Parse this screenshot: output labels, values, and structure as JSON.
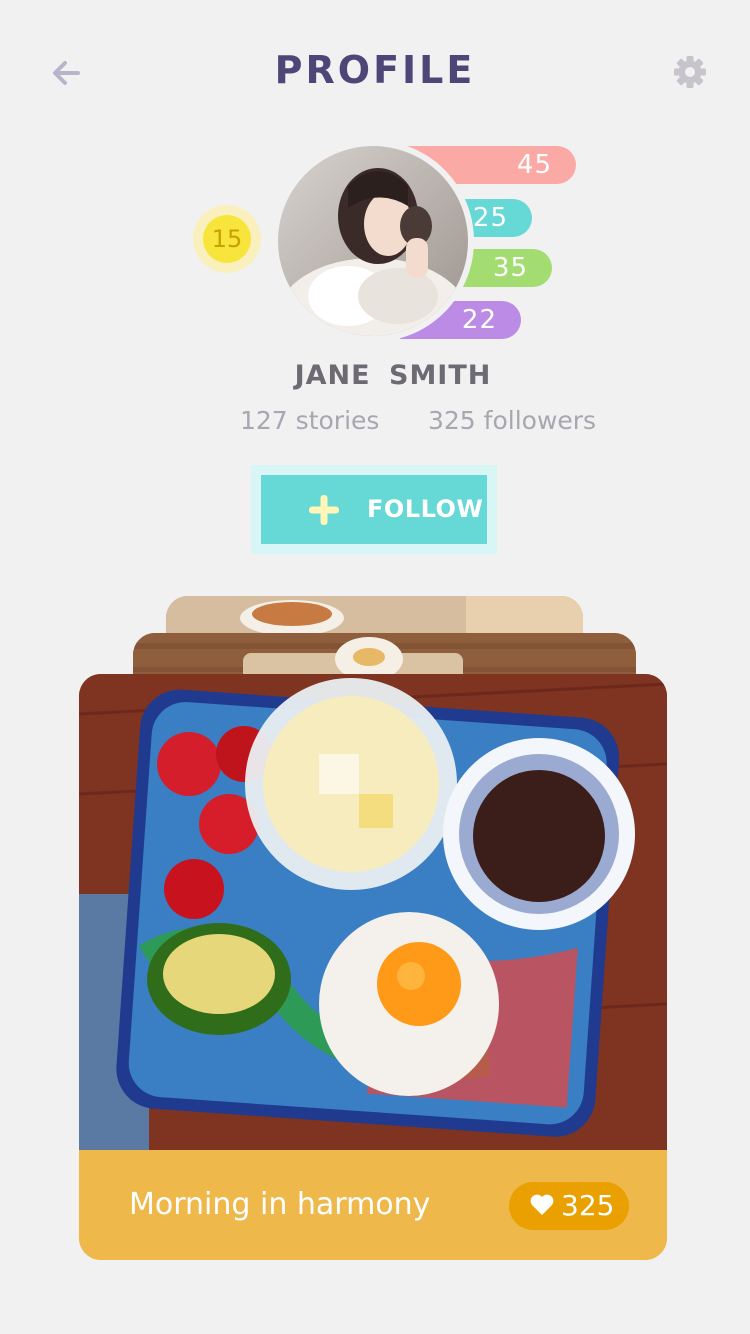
{
  "header": {
    "title": "PROFILE",
    "back_icon": "back-arrow-icon",
    "settings_icon": "gear-icon"
  },
  "profile": {
    "name": "JANE  SMITH",
    "stories": "127 stories",
    "followers": "325 followers",
    "level": "15",
    "stats": [
      "45",
      "25",
      "35",
      "22"
    ]
  },
  "follow_button": {
    "label": "FOLLOW",
    "icon": "plus-icon"
  },
  "card": {
    "title": "Morning in harmony",
    "likes": "325",
    "like_icon": "heart-icon"
  },
  "colors": {
    "title": "#4f4678",
    "accent_teal": "#66d8d6",
    "stat_pink": "#fba9a5",
    "stat_teal": "#66d8d6",
    "stat_green": "#a3dd71",
    "stat_purple": "#bb8be6",
    "level_yellow": "#f7e53c",
    "card_footer": "#efb84b",
    "like_pill": "#eaa000"
  }
}
